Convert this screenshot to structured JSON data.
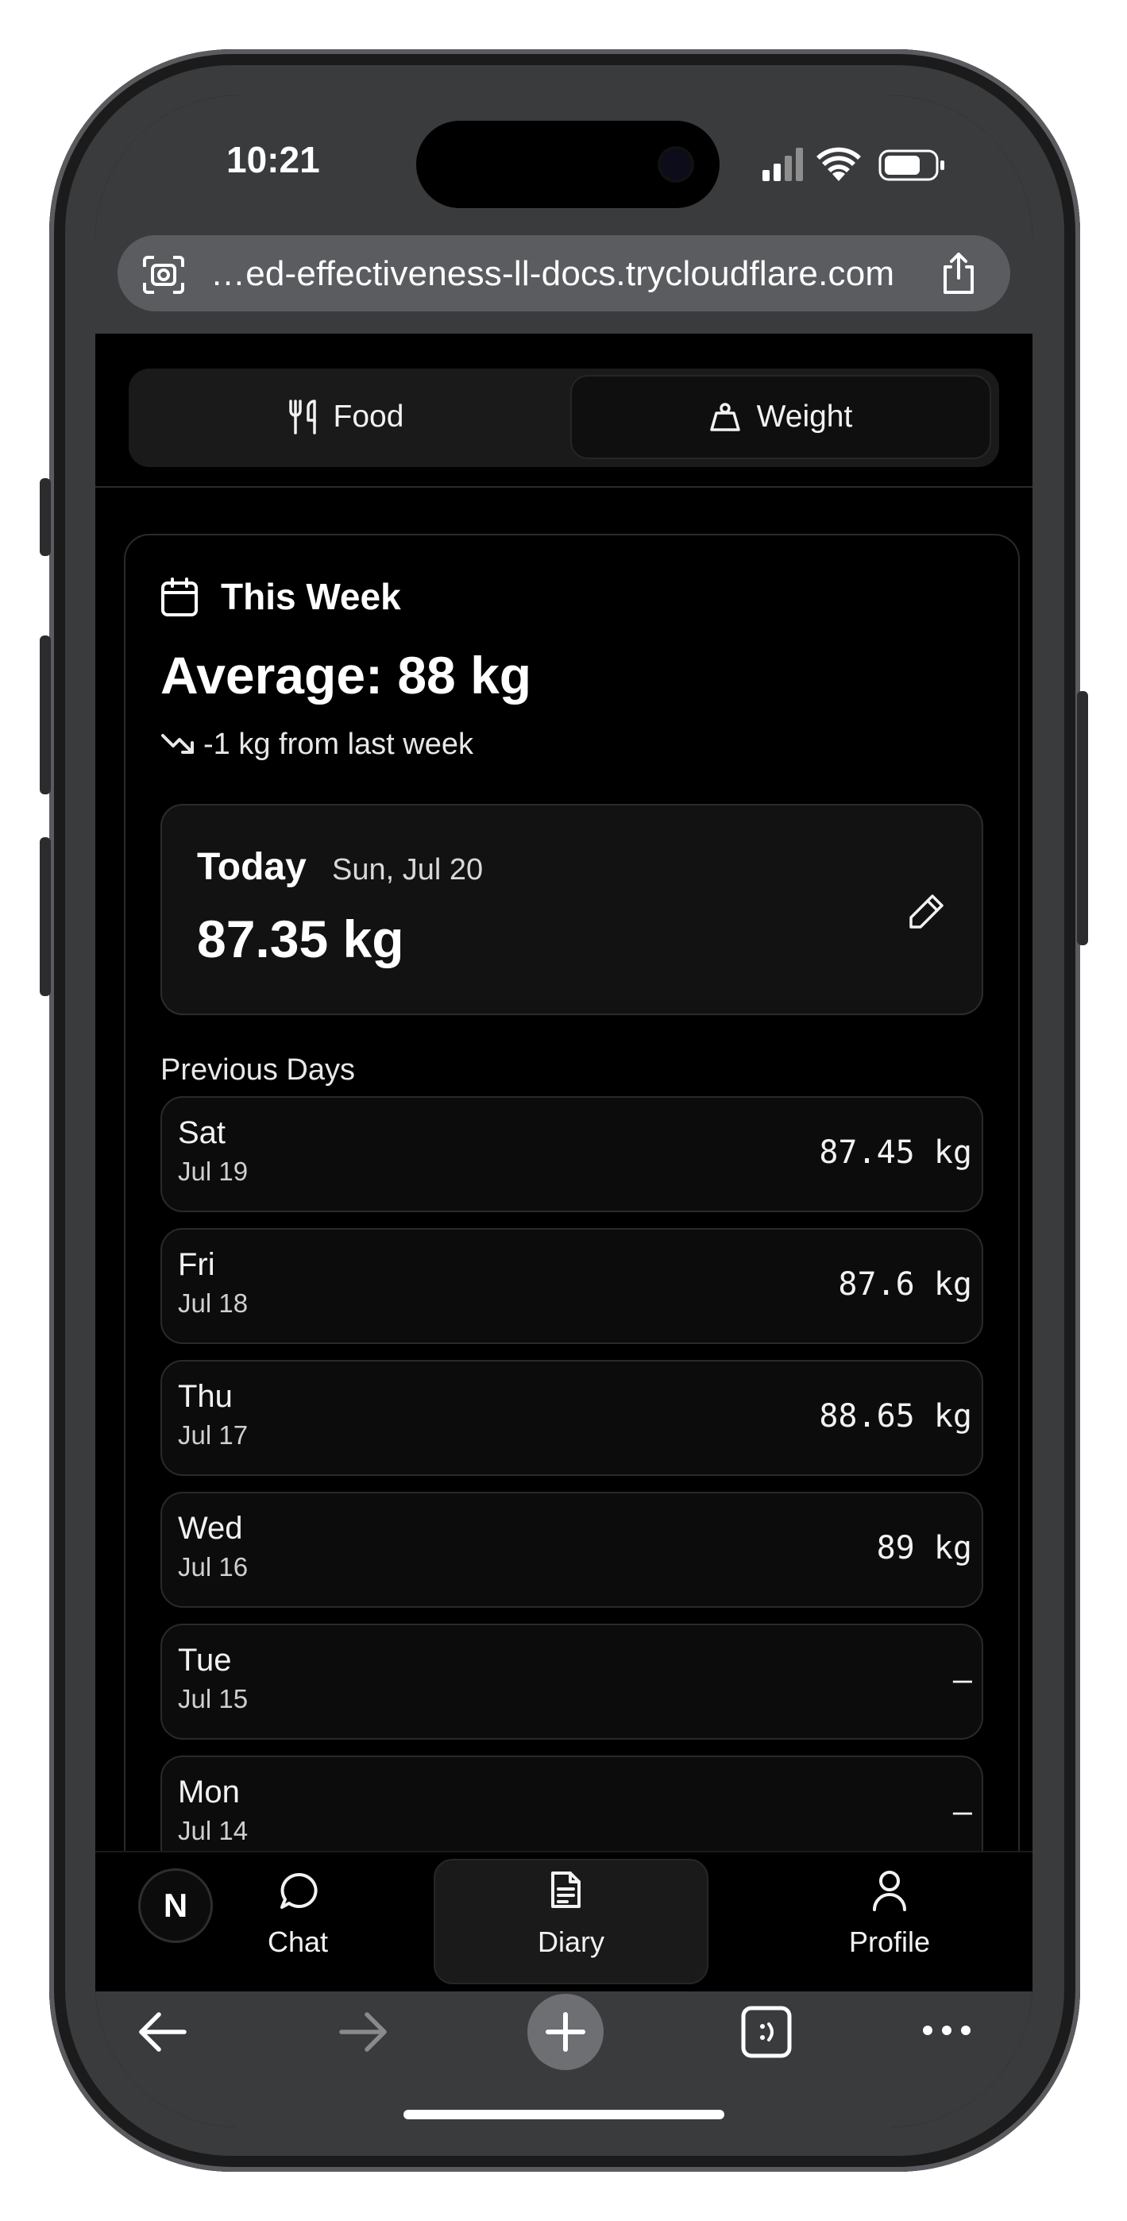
{
  "status_bar": {
    "time": "10:21"
  },
  "browser": {
    "url": "…ed-effectiveness-ll-docs.trycloudflare.com"
  },
  "tabs": {
    "food_label": "Food",
    "weight_label": "Weight",
    "active": "Weight"
  },
  "week": {
    "title": "This Week",
    "average": "Average: 88 kg",
    "trend": "-1 kg from last week"
  },
  "today": {
    "label": "Today",
    "date": "Sun, Jul 20",
    "value": "87.35 kg"
  },
  "previous": {
    "title": "Previous Days",
    "rows": [
      {
        "day": "Sat",
        "date": "Jul 19",
        "value": "87.45 kg"
      },
      {
        "day": "Fri",
        "date": "Jul 18",
        "value": "87.6 kg"
      },
      {
        "day": "Thu",
        "date": "Jul 17",
        "value": "88.65 kg"
      },
      {
        "day": "Wed",
        "date": "Jul 16",
        "value": "89 kg"
      },
      {
        "day": "Tue",
        "date": "Jul 15",
        "value": "—"
      },
      {
        "day": "Mon",
        "date": "Jul 14",
        "value": "—"
      }
    ]
  },
  "nav": {
    "avatar_initial": "N",
    "chat_label": "Chat",
    "diary_label": "Diary",
    "profile_label": "Profile",
    "active": "Diary"
  },
  "colors": {
    "background": "#000000",
    "card": "#121212",
    "chrome": "#3a3b3d",
    "text": "#f2f2f2"
  }
}
